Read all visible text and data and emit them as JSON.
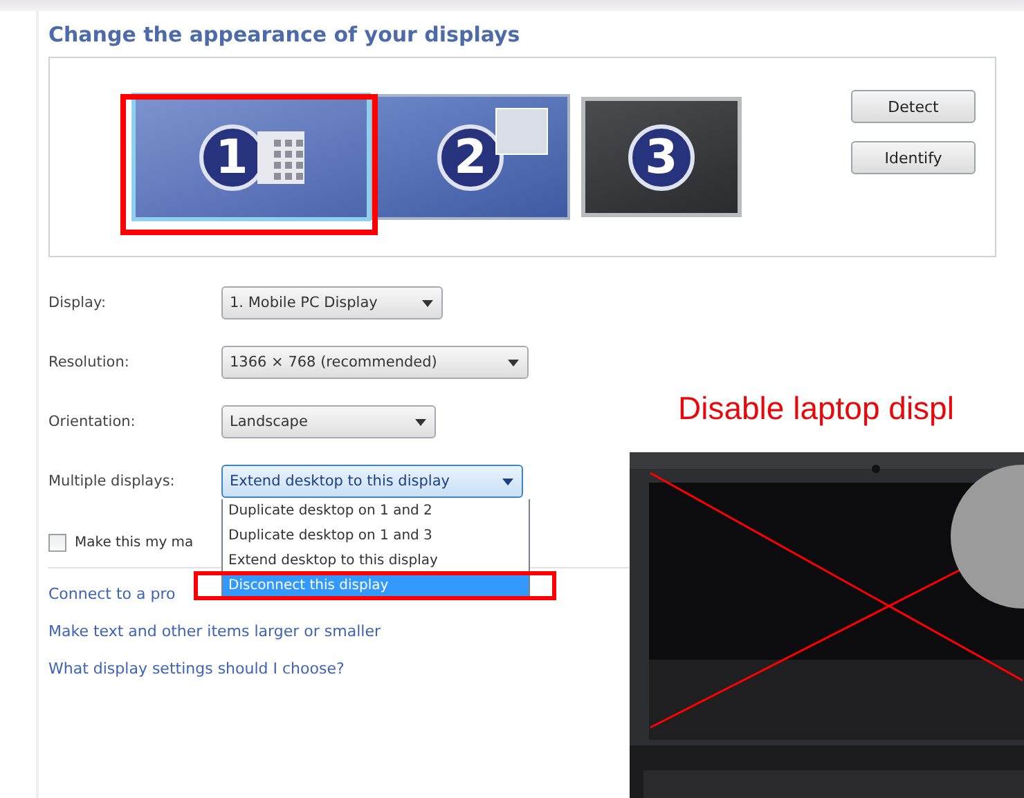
{
  "heading": "Change the appearance of your displays",
  "monitors": [
    {
      "number": "1",
      "selected": true,
      "active": true
    },
    {
      "number": "2",
      "selected": false,
      "active": true
    },
    {
      "number": "3",
      "selected": false,
      "active": false
    }
  ],
  "buttons": [
    "Detect",
    "Identify"
  ],
  "settings": [
    {
      "label": "Display:",
      "value": "1. Mobile PC Display",
      "focused": false
    },
    {
      "label": "Resolution:",
      "value": "1366 × 768 (recommended)",
      "focused": false
    },
    {
      "label": "Orientation:",
      "value": "Landscape",
      "focused": false
    },
    {
      "label": "Multiple displays:",
      "value": "Extend desktop to this display",
      "focused": true
    }
  ],
  "dropdown_options": [
    {
      "label": "Duplicate desktop on 1 and 2",
      "selected": false
    },
    {
      "label": "Duplicate desktop on 1 and 3",
      "selected": false
    },
    {
      "label": "Extend desktop to this display",
      "selected": false
    },
    {
      "label": "Disconnect this display",
      "selected": true
    }
  ],
  "checkbox": {
    "label": "Make this my ma",
    "checked": false
  },
  "links": [
    "Connect to a pro",
    "Make text and other items larger or smaller",
    "What display settings should I choose?"
  ],
  "annotation": {
    "caption": "Disable laptop displ"
  }
}
